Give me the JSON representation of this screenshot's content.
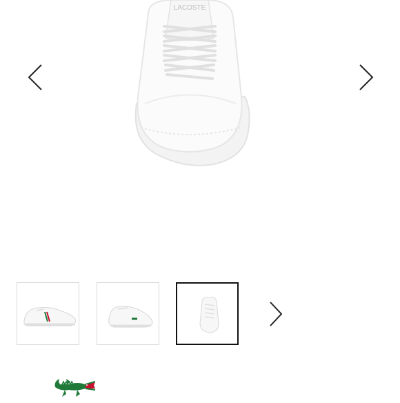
{
  "gallery": {
    "main_image_alt": "LACOSTE",
    "brand_text": "LACOSTE",
    "current_index": 3,
    "icons": {
      "prev": "chevron-left-icon",
      "next": "chevron-right-icon",
      "thumbs_next": "chevron-right-icon"
    },
    "thumbnails": [
      {
        "view": "side",
        "active": false
      },
      {
        "view": "angle",
        "active": false
      },
      {
        "view": "front",
        "active": true
      }
    ]
  },
  "brand": {
    "logo_icon": "crocodile-logo-icon",
    "colors": {
      "green": "#1f7a3a",
      "red": "#c8102e"
    }
  }
}
